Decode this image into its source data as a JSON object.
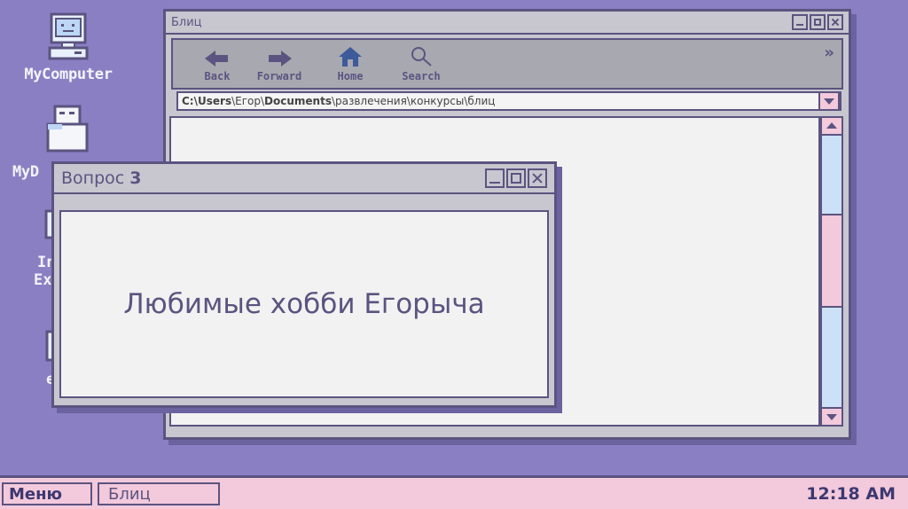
{
  "desktop": {
    "icons": [
      {
        "label": "MyComputer",
        "icon": "computer-icon"
      },
      {
        "label": "MyD",
        "icon": "documents-icon"
      },
      {
        "label_line1": "In",
        "label_line2": "Ex",
        "icon": "internet-explorer-icon"
      },
      {
        "label": "e",
        "icon": "edge-icon"
      }
    ]
  },
  "browser": {
    "title": "Блиц",
    "toolbar": {
      "back": "Back",
      "forward": "Forward",
      "home": "Home",
      "search": "Search"
    },
    "address": {
      "drive": "C:\\",
      "users": "Users",
      "sep1": "\\Егор\\",
      "documents": "Documents",
      "rest": "\\развлечения\\конкурсы\\блиц"
    }
  },
  "dialog": {
    "title_word": "Вопрос ",
    "title_number": "3",
    "text": "Любимые хобби Егорыча"
  },
  "taskbar": {
    "menu_label": "Меню",
    "task_label": "Блиц",
    "clock": "12:18 AM"
  },
  "colors": {
    "desktop": "#8b7fc4",
    "frame": "#5b5480",
    "pink": "#f3c9dc",
    "blue": "#cce0f7",
    "panel": "#c8c6cf"
  }
}
